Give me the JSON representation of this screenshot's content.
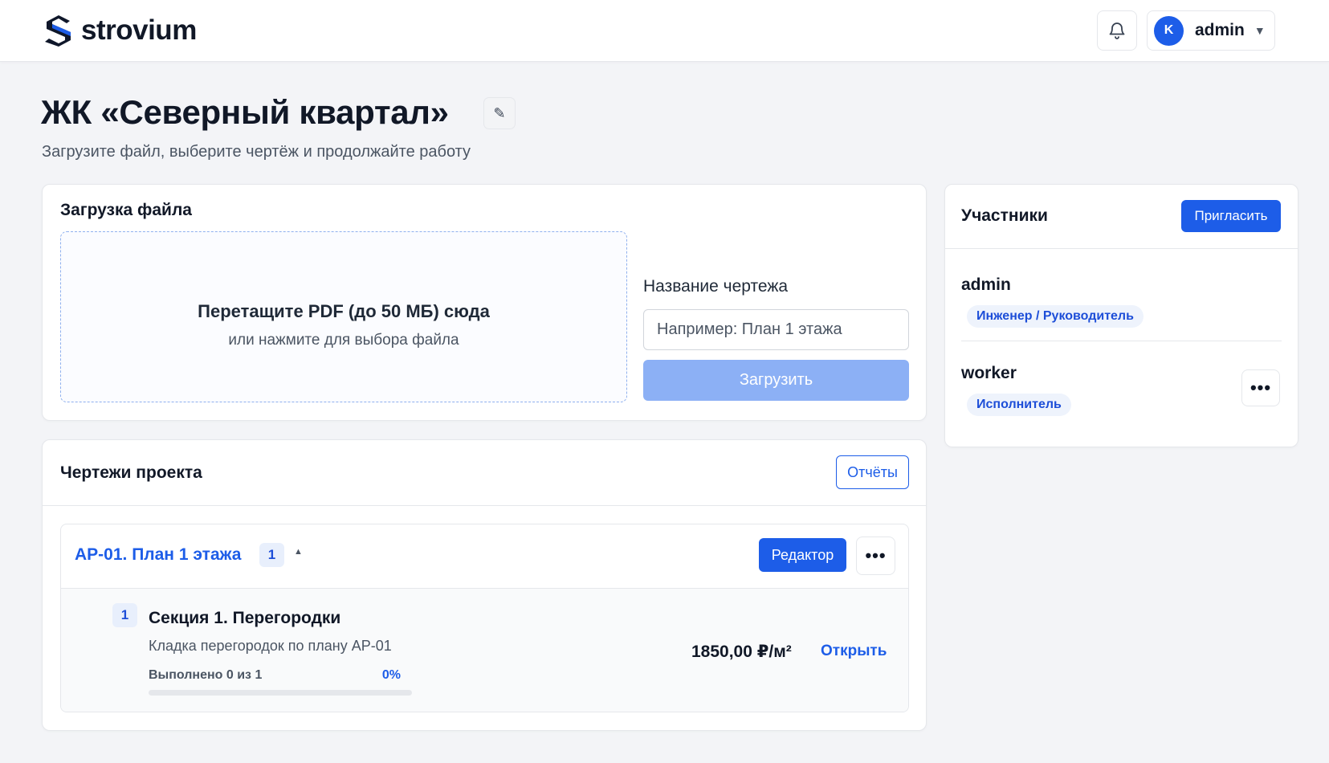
{
  "header": {
    "brand": "strovium",
    "brand_color": "#1d5de8",
    "icons": [
      "logo-icon",
      "bell-icon",
      "chevron-down-icon"
    ],
    "user": {
      "initial": "K",
      "name": "admin",
      "caret": "▼"
    }
  },
  "page": {
    "title": "ЖК «Северный квартал»",
    "edit_icon": "✎",
    "subtitle": "Загрузите файл, выберите чертёж и продолжайте работу"
  },
  "upload": {
    "title": "Загрузка файла",
    "dropzone_title": "Перетащите PDF (до 50 МБ) сюда",
    "dropzone_subtitle": "или нажмите для выбора файла",
    "name_label": "Название чертежа",
    "name_placeholder": "Например: План 1 этажа",
    "name_value": "",
    "upload_button": "Загрузить"
  },
  "members": {
    "title": "Участники",
    "invite_button": "Пригласить",
    "items": [
      {
        "name": "admin",
        "role": "Инженер / Руководитель"
      },
      {
        "name": "worker",
        "role": "Исполнитель"
      }
    ],
    "more_label": "•••"
  },
  "drawings": {
    "title": "Чертежи проекта",
    "reports_button": "Отчёты",
    "items": [
      {
        "title": "АР-01. План 1 этажа",
        "count": "1",
        "toggle": "▲",
        "editor_button": "Редактор",
        "more_label": "•••",
        "sections": [
          {
            "number": "1",
            "title": "Секция 1. Перегородки",
            "description": "Кладка перегородок по плану АР-01",
            "progress_label": "Выполнено 0 из 1",
            "progress_percent": "0%",
            "progress_fraction": 0,
            "price": "1850,00 ₽/м²",
            "open_link": "Открыть"
          }
        ]
      }
    ]
  }
}
